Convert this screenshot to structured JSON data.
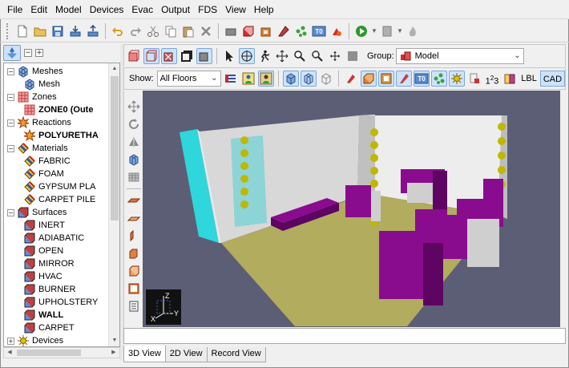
{
  "menu": [
    "File",
    "Edit",
    "Model",
    "Devices",
    "Evac",
    "Output",
    "FDS",
    "View",
    "Help"
  ],
  "main_toolbar": {
    "icons": [
      "new-file-icon",
      "open-folder-icon",
      "save-icon",
      "import-icon",
      "export-icon",
      "undo-icon",
      "redo-icon",
      "cut-icon",
      "copy-icon",
      "paste-icon",
      "delete-icon",
      "layer-icon",
      "obstruction-icon",
      "hole-icon",
      "vent-icon",
      "particle-icon",
      "t0-icon",
      "fire-icon",
      "run-icon",
      "report-icon",
      "flame-icon"
    ],
    "t0_label": "T0"
  },
  "view_toolbar": {
    "group_label": "Group:",
    "group_value": "Model"
  },
  "show_toolbar": {
    "show_label": "Show:",
    "floor_value": "All Floors",
    "t0_label": "T0",
    "num_label": "1",
    "num_sup": "2",
    "num_last": "3",
    "lbl_label": "LBL",
    "cad_label": "CAD"
  },
  "tree": {
    "items": [
      {
        "label": "Meshes",
        "level": 0,
        "expander": "−",
        "icon": "mesh-icon",
        "bold": false
      },
      {
        "label": "Mesh",
        "level": 1,
        "icon": "mesh-icon",
        "bold": false
      },
      {
        "label": "Zones",
        "level": 0,
        "expander": "−",
        "icon": "zone-icon",
        "bold": false
      },
      {
        "label": "ZONE0 (Oute",
        "level": 1,
        "icon": "zone-icon",
        "bold": true
      },
      {
        "label": "Reactions",
        "level": 0,
        "expander": "−",
        "icon": "reaction-icon",
        "bold": false
      },
      {
        "label": "POLYURETHA",
        "level": 1,
        "icon": "reaction-icon",
        "bold": true
      },
      {
        "label": "Materials",
        "level": 0,
        "expander": "−",
        "icon": "material-icon",
        "bold": false
      },
      {
        "label": "FABRIC",
        "level": 1,
        "icon": "material-icon",
        "bold": false
      },
      {
        "label": "FOAM",
        "level": 1,
        "icon": "material-icon",
        "bold": false
      },
      {
        "label": "GYPSUM PLA",
        "level": 1,
        "icon": "material-icon",
        "bold": false
      },
      {
        "label": "CARPET PILE",
        "level": 1,
        "icon": "material-icon",
        "bold": false
      },
      {
        "label": "Surfaces",
        "level": 0,
        "expander": "−",
        "icon": "surface-icon",
        "bold": false
      },
      {
        "label": "INERT",
        "level": 1,
        "icon": "surface-icon",
        "bold": false
      },
      {
        "label": "ADIABATIC",
        "level": 1,
        "icon": "surface-icon",
        "bold": false
      },
      {
        "label": "OPEN",
        "level": 1,
        "icon": "surface-icon",
        "bold": false
      },
      {
        "label": "MIRROR",
        "level": 1,
        "icon": "surface-icon",
        "bold": false
      },
      {
        "label": "HVAC",
        "level": 1,
        "icon": "surface-icon",
        "bold": false
      },
      {
        "label": "BURNER",
        "level": 1,
        "icon": "surface-icon",
        "bold": false
      },
      {
        "label": "UPHOLSTERY",
        "level": 1,
        "icon": "surface-icon",
        "bold": false
      },
      {
        "label": "WALL",
        "level": 1,
        "icon": "surface-icon",
        "bold": true
      },
      {
        "label": "CARPET",
        "level": 1,
        "icon": "surface-icon",
        "bold": false
      },
      {
        "label": "Devices",
        "level": 0,
        "expander": "+",
        "icon": "device-icon",
        "bold": false
      }
    ]
  },
  "axis": {
    "z": "Z",
    "x": "X",
    "y": "Y"
  },
  "view_tabs": [
    {
      "label": "3D View",
      "active": true
    },
    {
      "label": "2D View",
      "active": false
    },
    {
      "label": "Record View",
      "active": false
    }
  ],
  "colors": {
    "viewport_bg": "#5c5e76",
    "floor": "#b1ac5e",
    "furniture": "#8a0c8e",
    "furniture_dark": "#5e0462",
    "device": "#bfb800",
    "mirror_wall": "#2fd6dc"
  }
}
